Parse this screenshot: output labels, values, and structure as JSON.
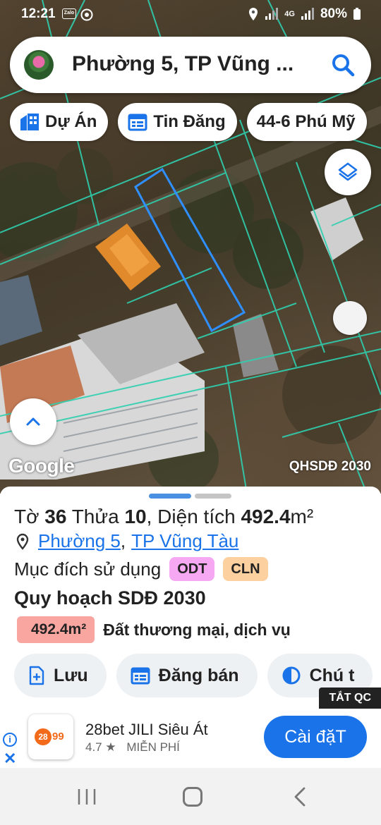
{
  "status_bar": {
    "time": "12:21",
    "app_icon_1": "Zalo",
    "network": "4G",
    "battery": "80%"
  },
  "search": {
    "query": "Phường 5, TP Vũng ..."
  },
  "chips": [
    {
      "label": "Dự Án",
      "icon": "building-icon"
    },
    {
      "label": "Tin Đăng",
      "icon": "calendar-icon"
    },
    {
      "label": "44-6 Phú Mỹ",
      "icon": ""
    }
  ],
  "map": {
    "logo": "Google",
    "caption": "QHSDĐ 2030"
  },
  "parcel": {
    "to_label": "Tờ",
    "to_value": "36",
    "thua_label": "Thửa",
    "thua_value": "10",
    "area_label": ", Diện tích",
    "area_value": "492.4",
    "area_unit": "m²",
    "ward": "Phường 5",
    "city": "TP Vũng Tàu",
    "purpose_label": "Mục đích sử dụng",
    "purpose_tags": [
      "ODT",
      "CLN"
    ],
    "plan_title": "Quy hoạch SDĐ 2030",
    "plan_area": "492.4m²",
    "plan_desc": "Đất thương mại, dịch vụ"
  },
  "actions": [
    {
      "label": "Lưu",
      "icon": "save-icon"
    },
    {
      "label": "Đăng bán",
      "icon": "calendar-icon"
    },
    {
      "label": "Chú t",
      "icon": "contrast-icon"
    }
  ],
  "ad": {
    "close_label": "TẮT QC",
    "logo_circle": "28",
    "logo_num": "99",
    "title": "28bet JILI Siêu Át",
    "rating": "4.7 ★",
    "price": "MIỄN PHÍ",
    "install": "Cài đặT"
  },
  "colors": {
    "accent": "#1a73e8",
    "odt": "#f7a8f2",
    "cln": "#fdd0a0",
    "plan_badge": "#f9a6a0",
    "parcel_outline": "#2f8fff",
    "parcel_lines": "#2fd0b0"
  }
}
